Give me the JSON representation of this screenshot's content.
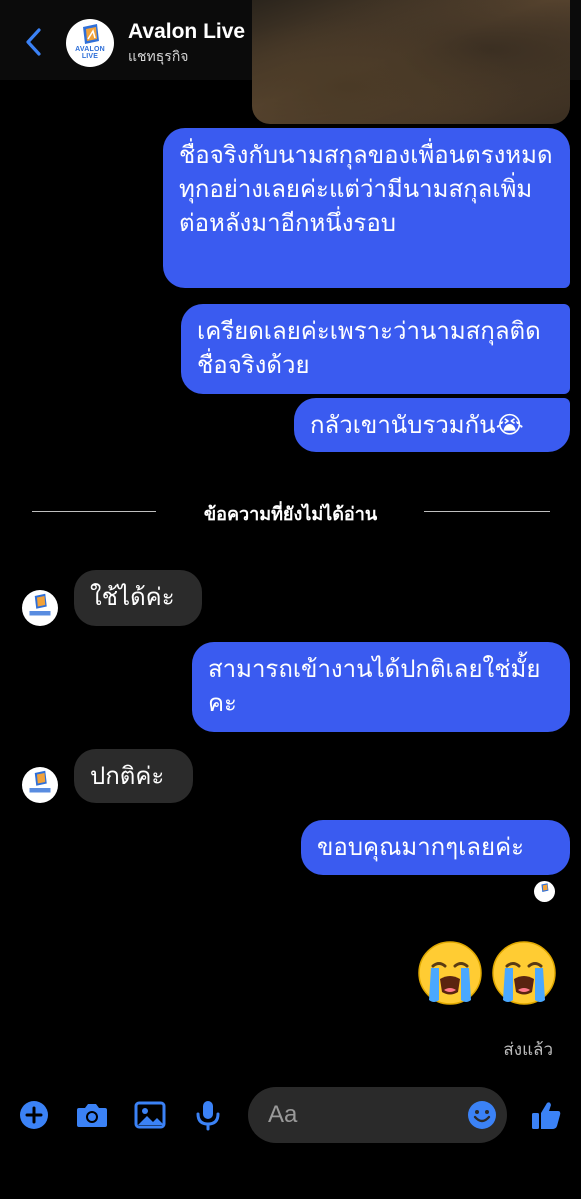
{
  "header": {
    "title": "Avalon Live",
    "subtitle": "แชทธุรกิจ",
    "avatar_logo_text": "AVALON LIVE"
  },
  "messages": [
    {
      "side": "out",
      "text": "ชื่อจริงกับนามสกุลของเพื่อนตรงหมดทุกอย่างเลยค่ะแต่ว่ามีนามสกุลเพิ่มต่อหลังมาอีกหนึ่งรอบ"
    },
    {
      "side": "out",
      "text": "เครียดเลยค่ะเพราะว่านามสกุลติดชื่อจริงด้วย"
    },
    {
      "side": "out",
      "text": "กลัวเขานับรวมกัน😭"
    },
    {
      "side": "in",
      "text": "ใช้ได้ค่ะ"
    },
    {
      "side": "out",
      "text": "สามารถเข้างานได้ปกติเลยใช่มั้ยคะ"
    },
    {
      "side": "in",
      "text": "ปกติค่ะ"
    },
    {
      "side": "out",
      "text": "ขอบคุณมากๆเลยค่ะ"
    }
  ],
  "divider": {
    "label": "ข้อความที่ยังไม่ได้อ่าน"
  },
  "emoji_message": {
    "emojis": [
      "loudly-crying-face",
      "loudly-crying-face"
    ]
  },
  "status": {
    "label": "ส่งแล้ว"
  },
  "composer": {
    "placeholder": "Aa",
    "icons": [
      "plus-circle-icon",
      "camera-icon",
      "image-icon",
      "microphone-icon",
      "emoji-icon",
      "thumbs-up-icon"
    ]
  },
  "colors": {
    "outgoing_bubble": "#3a5bf0",
    "incoming_bubble": "#2b2b2b",
    "accent": "#3b82f6",
    "background": "#000000"
  }
}
